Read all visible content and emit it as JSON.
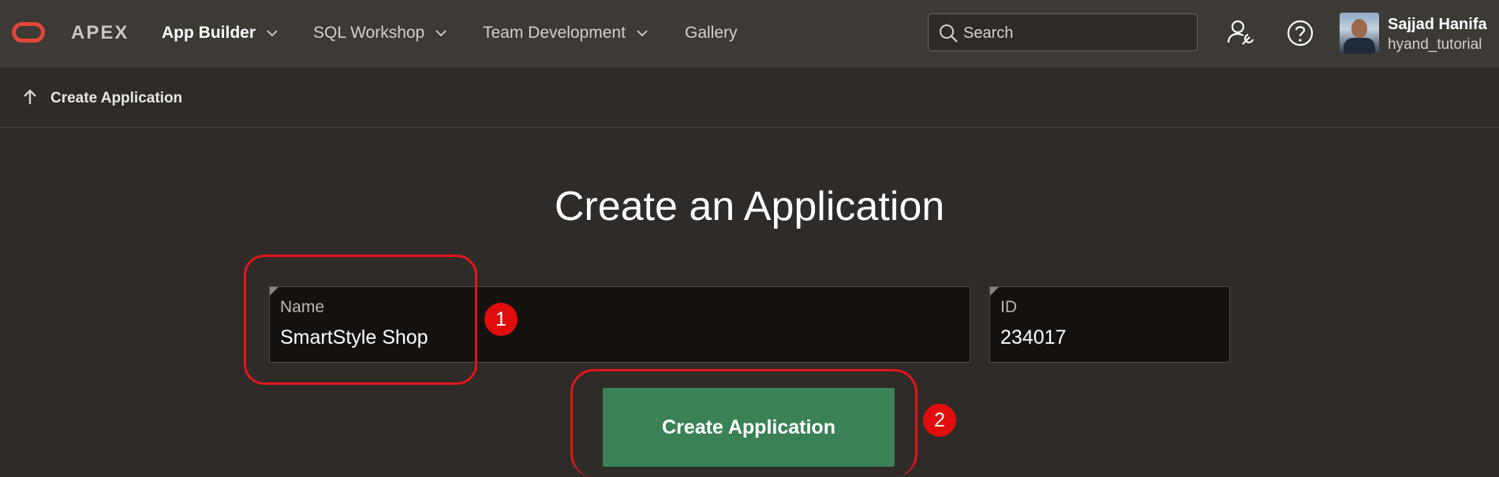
{
  "header": {
    "brand": "APEX",
    "nav": [
      {
        "label": "App Builder",
        "active": true,
        "has_dropdown": true
      },
      {
        "label": "SQL Workshop",
        "active": false,
        "has_dropdown": true
      },
      {
        "label": "Team Development",
        "active": false,
        "has_dropdown": true
      },
      {
        "label": "Gallery",
        "active": false,
        "has_dropdown": false
      }
    ],
    "search": {
      "placeholder": "Search",
      "value": ""
    },
    "icons": [
      "administration-icon",
      "help-icon"
    ],
    "user": {
      "name": "Sajjad Hanifa",
      "workspace": "hyand_tutorial"
    }
  },
  "breadcrumb": {
    "label": "Create Application",
    "icon": "up-arrow-icon"
  },
  "main": {
    "title": "Create an Application",
    "name_field": {
      "label": "Name",
      "value": "SmartStyle Shop"
    },
    "id_field": {
      "label": "ID",
      "value": "234017"
    },
    "create_button": {
      "label": "Create Application"
    }
  },
  "annotations": [
    {
      "number": "1",
      "target": "name-field"
    },
    {
      "number": "2",
      "target": "create-application-button"
    }
  ],
  "colors": {
    "background": "#2f2b28",
    "header": "#3d3935",
    "logo": "#e0463a",
    "primary_button": "#3a8255",
    "annotation": "#e4161b"
  }
}
